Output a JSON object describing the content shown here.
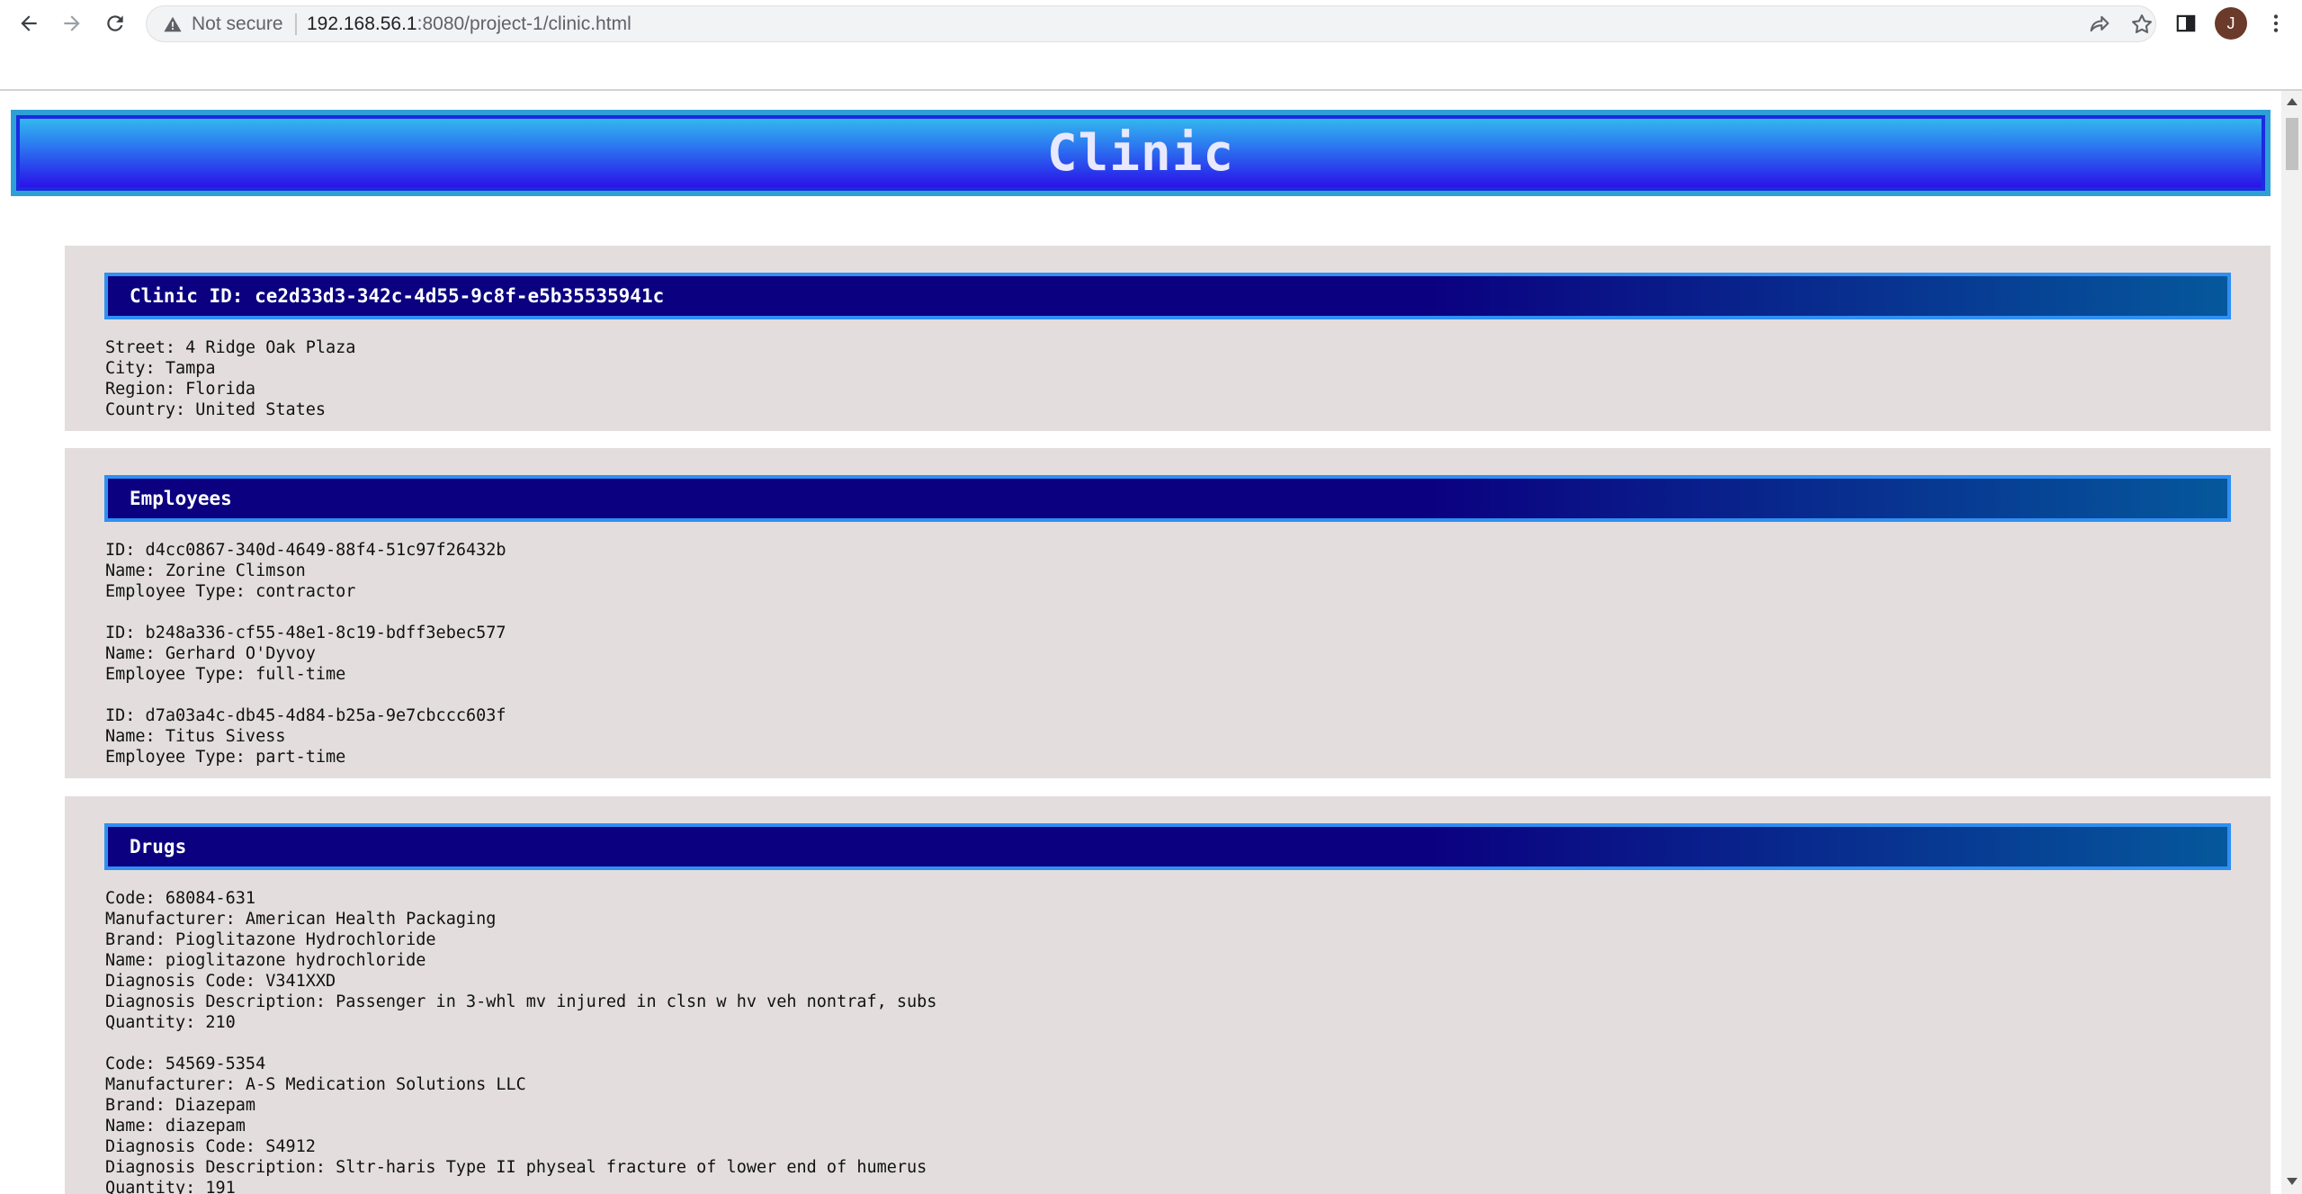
{
  "browser": {
    "security_label": "Not secure",
    "url_host": "192.168.56.1",
    "url_rest": ":8080/project-1/clinic.html",
    "avatar_initial": "J"
  },
  "page": {
    "title": "Clinic"
  },
  "clinic": {
    "header": "Clinic ID: ce2d33d3-342c-4d55-9c8f-e5b35535941c",
    "lines": [
      "Street: 4 Ridge Oak Plaza",
      "City: Tampa",
      "Region: Florida",
      "Country: United States"
    ]
  },
  "employees": {
    "header": "Employees",
    "records": [
      [
        "ID: d4cc0867-340d-4649-88f4-51c97f26432b",
        "Name: Zorine Climson",
        "Employee Type: contractor"
      ],
      [
        "ID: b248a336-cf55-48e1-8c19-bdff3ebec577",
        "Name: Gerhard O'Dyvoy",
        "Employee Type: full-time"
      ],
      [
        "ID: d7a03a4c-db45-4d84-b25a-9e7cbccc603f",
        "Name: Titus Sivess",
        "Employee Type: part-time"
      ]
    ]
  },
  "drugs": {
    "header": "Drugs",
    "records": [
      [
        "Code: 68084-631",
        "Manufacturer: American Health Packaging",
        "Brand: Pioglitazone Hydrochloride",
        "Name: pioglitazone hydrochloride",
        "Diagnosis Code: V341XXD",
        "Diagnosis Description: Passenger in 3-whl mv injured in clsn w hv veh nontraf, subs",
        "Quantity: 210"
      ],
      [
        "Code: 54569-5354",
        "Manufacturer: A-S Medication Solutions LLC",
        "Brand: Diazepam",
        "Name: diazepam",
        "Diagnosis Code: S4912",
        "Diagnosis Description: Sltr-haris Type II physeal fracture of lower end of humerus",
        "Quantity: 191"
      ]
    ]
  }
}
